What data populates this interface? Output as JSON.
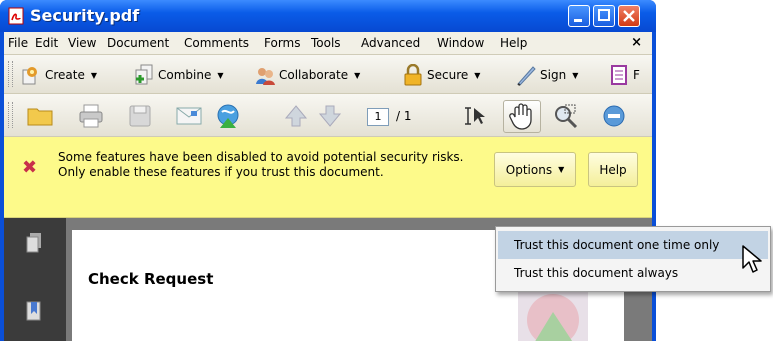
{
  "window": {
    "title": "Security.pdf"
  },
  "menu": {
    "items": [
      "File",
      "Edit",
      "View",
      "Document",
      "Comments",
      "Forms",
      "Tools",
      "Advanced",
      "Window",
      "Help"
    ],
    "close_glyph": "×"
  },
  "toolbar1": {
    "create": "Create",
    "combine": "Combine",
    "collaborate": "Collaborate",
    "secure": "Secure",
    "sign": "Sign",
    "trailing": "F"
  },
  "toolbar2": {
    "page_current": "1",
    "page_total": "/ 1"
  },
  "message_bar": {
    "text": "Some features have been disabled to avoid potential security risks. Only enable these features if you trust this document.",
    "options_label": "Options",
    "help_label": "Help"
  },
  "document": {
    "heading": "Check Request"
  },
  "options_menu": {
    "items": [
      "Trust this document one time only",
      "Trust this document always"
    ]
  },
  "colors": {
    "titlebar": "#0a5ce8",
    "message_bar": "#fdfa8a",
    "menu_highlight": "#c2d3e4"
  }
}
